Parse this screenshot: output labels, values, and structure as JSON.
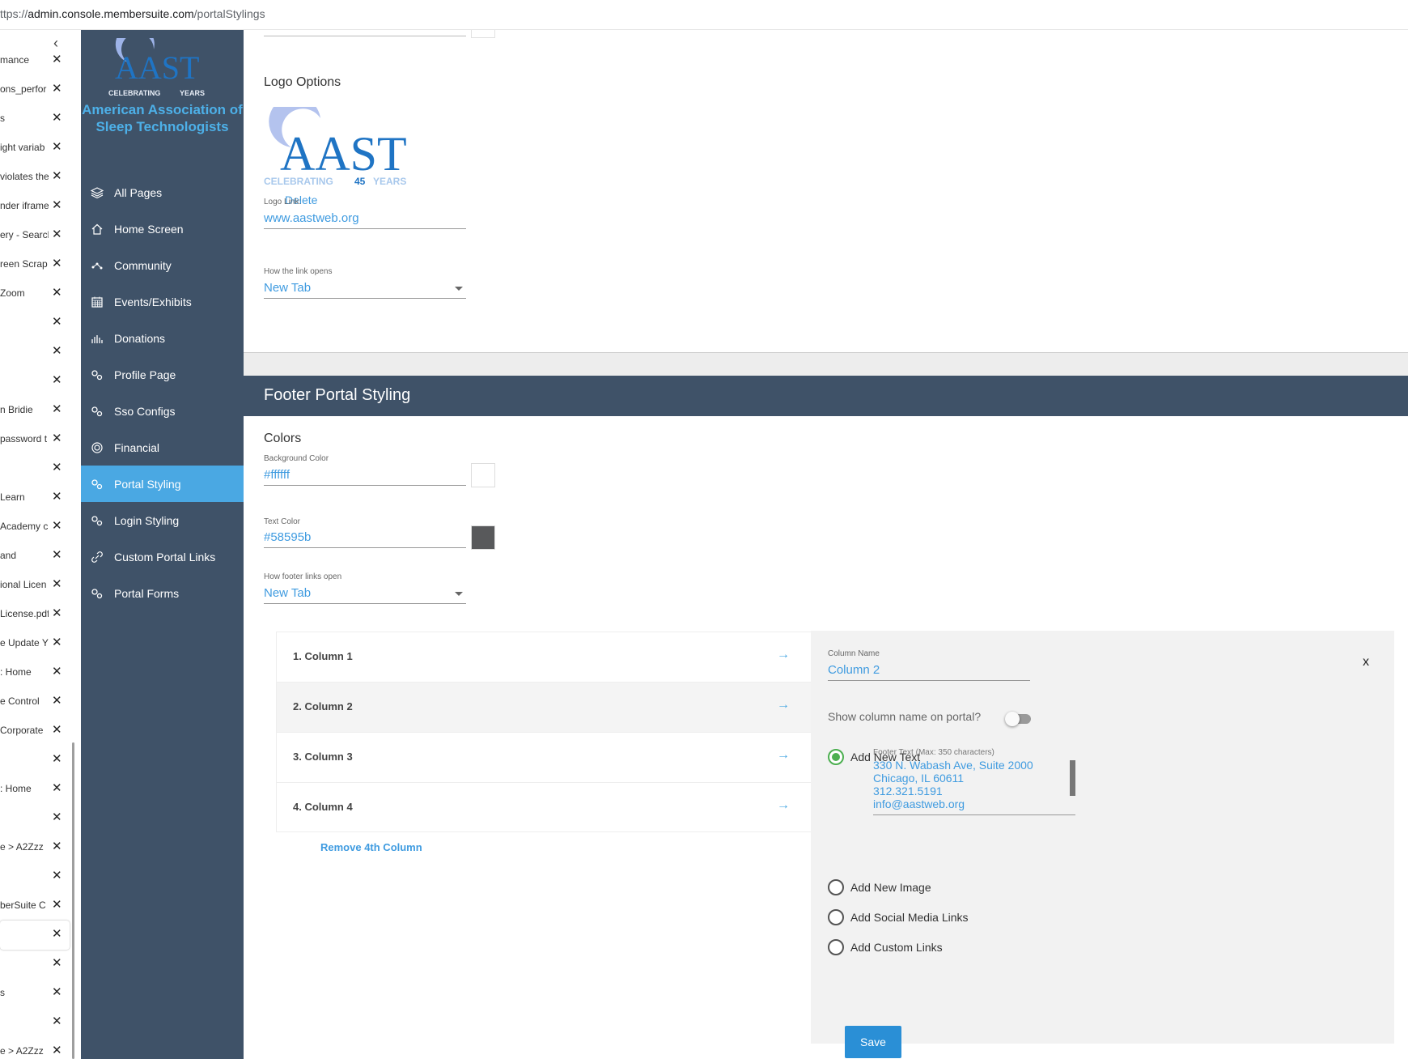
{
  "browser": {
    "url_scheme": "ttps://",
    "url_host": "admin.console.membersuite.com",
    "url_path": "/portalStylings",
    "tabs": [
      {
        "title": "mance"
      },
      {
        "title": "ons_perfor"
      },
      {
        "title": "s"
      },
      {
        "title": "ight variab"
      },
      {
        "title": "violates the"
      },
      {
        "title": "nder iframe"
      },
      {
        "title": "ery - Search"
      },
      {
        "title": "reen Scrap"
      },
      {
        "title": "Zoom"
      },
      {
        "title": ""
      },
      {
        "title": ""
      },
      {
        "title": ""
      },
      {
        "title": "n Bridie"
      },
      {
        "title": "password t"
      },
      {
        "title": ""
      },
      {
        "title": "Learn"
      },
      {
        "title": "Academy c"
      },
      {
        "title": "and"
      },
      {
        "title": "ional Licen"
      },
      {
        "title": "License.pdf"
      },
      {
        "title": "e Update Y"
      },
      {
        "title": ": Home"
      },
      {
        "title": "e Control"
      },
      {
        "title": "Corporate"
      },
      {
        "title": ""
      },
      {
        "title": ": Home"
      },
      {
        "title": ""
      },
      {
        "title": "e > A2Zzz"
      },
      {
        "title": ""
      },
      {
        "title": "berSuite C"
      },
      {
        "title": ""
      },
      {
        "title": ""
      },
      {
        "title": "s"
      },
      {
        "title": ""
      },
      {
        "title": "e > A2Zzz"
      }
    ],
    "close_glyph": "✕",
    "collapse_glyph": "‹"
  },
  "sidebar": {
    "logo_text": "AAST",
    "logo_tagline_left": "CELEBRATING",
    "logo_tagline_right": "YEARS",
    "org_name": "American Association of Sleep Technologists",
    "items": [
      {
        "label": "All Pages",
        "icon": "layers-icon"
      },
      {
        "label": "Home Screen",
        "icon": "home-icon"
      },
      {
        "label": "Community",
        "icon": "network-icon"
      },
      {
        "label": "Events/Exhibits",
        "icon": "calendar-icon"
      },
      {
        "label": "Donations",
        "icon": "donation-icon"
      },
      {
        "label": "Profile Page",
        "icon": "gears-icon"
      },
      {
        "label": "Sso Configs",
        "icon": "gears-icon"
      },
      {
        "label": "Financial",
        "icon": "target-icon"
      },
      {
        "label": "Portal Styling",
        "icon": "gears-icon"
      },
      {
        "label": "Login Styling",
        "icon": "gears-icon"
      },
      {
        "label": "Custom Portal Links",
        "icon": "link-icon"
      },
      {
        "label": "Portal Forms",
        "icon": "gears-icon"
      }
    ],
    "active_index": 8,
    "colors": {
      "bg": "#3f5268",
      "active": "#4aa8e3",
      "org": "#4db0e8"
    }
  },
  "logo_options": {
    "title": "Logo Options",
    "logo_text": "AAST",
    "logo_tagline": "CELEBRATING",
    "logo_years_number": "45",
    "logo_years": "YEARS",
    "delete_label": "Delete",
    "logo_link_label": "Logo Link:",
    "logo_link_value": "www.aastweb.org",
    "link_opens_label": "How the link opens",
    "link_opens_value": "New Tab"
  },
  "footer": {
    "header": "Footer Portal Styling",
    "colors_title": "Colors",
    "bg_color_label": "Background Color",
    "bg_color_value": "#ffffff",
    "text_color_label": "Text Color",
    "text_color_value": "#58595b",
    "links_open_label": "How footer links open",
    "links_open_value": "New Tab",
    "columns": [
      {
        "label": "1. Column 1"
      },
      {
        "label": "2. Column 2"
      },
      {
        "label": "3. Column 3"
      },
      {
        "label": "4. Column 4"
      }
    ],
    "selected_column": 1,
    "remove_label": "Remove 4th Column",
    "arrow_glyph": "→"
  },
  "column_editor": {
    "close_label": "x",
    "column_name_label": "Column Name",
    "column_name_value": "Column 2",
    "show_name_label": "Show column name on portal?",
    "show_name_on": false,
    "options": [
      {
        "label": "Add New Text",
        "selected": true
      },
      {
        "label": "Add New Image",
        "selected": false
      },
      {
        "label": "Add Social Media Links",
        "selected": false
      },
      {
        "label": "Add Custom Links",
        "selected": false
      }
    ],
    "footer_text_label": "Footer Text (Max: 350 characters)",
    "footer_text_lines": [
      "330 N. Wabash Ave, Suite 2000",
      "Chicago, IL 60611",
      "312.321.5191",
      "info@aastweb.org"
    ],
    "save_label": "Save"
  }
}
